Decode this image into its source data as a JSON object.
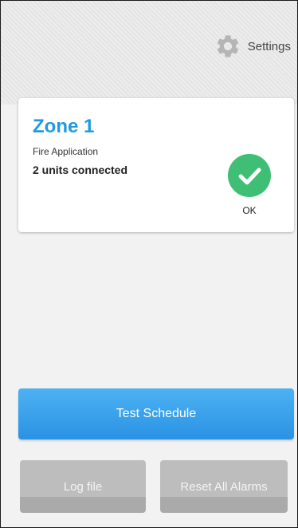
{
  "header": {
    "settings_label": "Settings",
    "settings_icon": "gear-icon"
  },
  "zone_card": {
    "title": "Zone 1",
    "subtitle": "Fire Application",
    "units": "2 units connected",
    "status_icon": "check-circle-icon",
    "status_label": "OK"
  },
  "actions": {
    "test_schedule": "Test Schedule",
    "log_file": "Log file",
    "reset_alarms": "Reset All Alarms"
  },
  "colors": {
    "accent": "#1f9ae0",
    "primary_button": "#3aa3ec",
    "status_ok": "#3fbf75",
    "disabled_button": "#bdbdbd"
  }
}
